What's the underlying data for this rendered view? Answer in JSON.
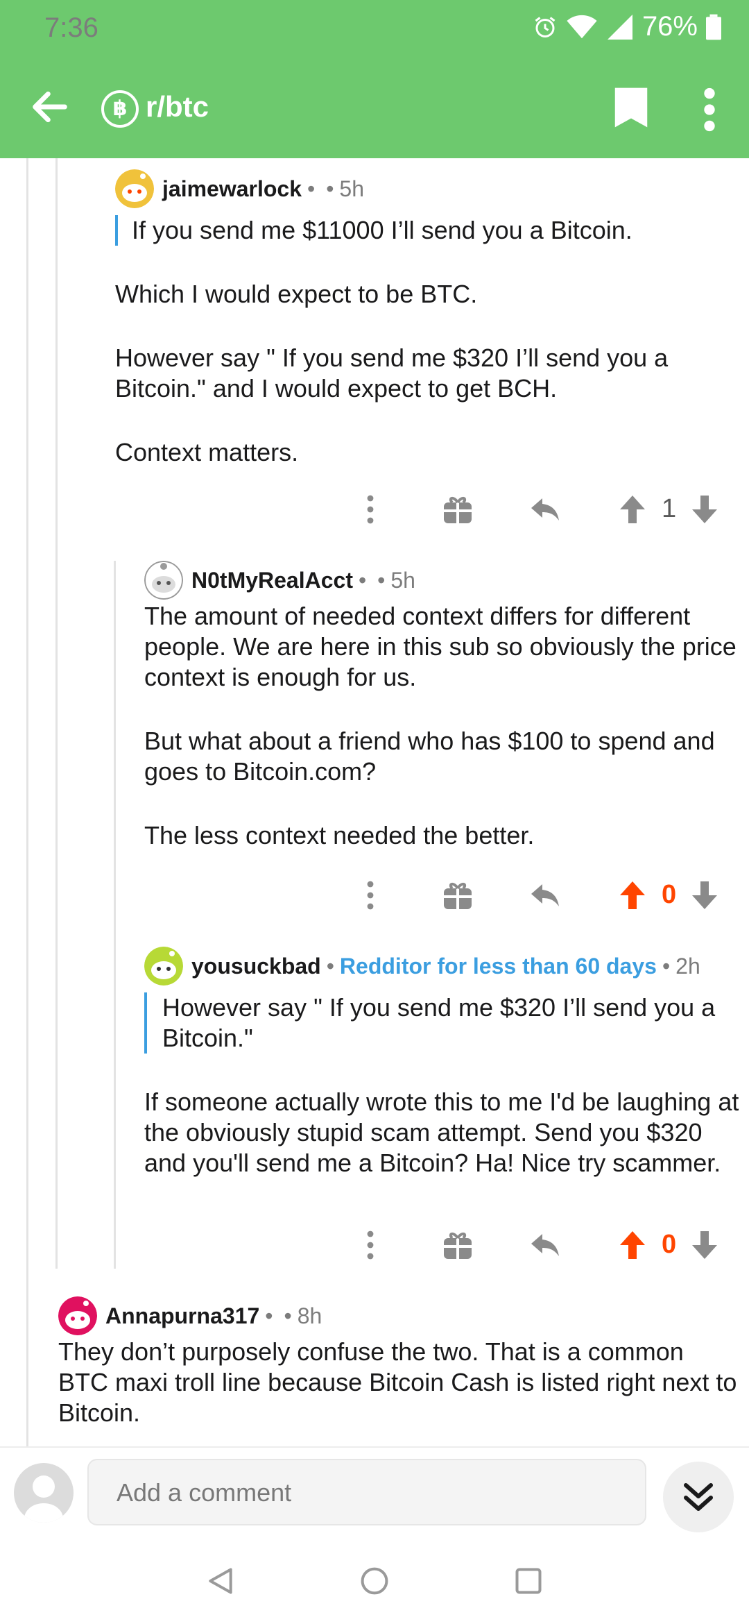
{
  "status_bar": {
    "time": "7:36",
    "battery": "76%"
  },
  "toolbar": {
    "subreddit": "r/btc",
    "back_icon": "arrow-left-icon",
    "bookmark_icon": "bookmark-icon",
    "more_icon": "more-vert-icon"
  },
  "comments": [
    {
      "username": "jaimewarlock",
      "time": "5h",
      "quote": "If you send me $11000 I’ll send you a Bitcoin.",
      "paragraphs": [
        "Which I would expect to be BTC.",
        "However say \" If you send me $320 I’ll send you a Bitcoin.\" and I would expect to get BCH.",
        "Context matters."
      ],
      "score": "1",
      "upvoted": false
    },
    {
      "username": "N0tMyRealAcct",
      "time": "5h",
      "paragraphs": [
        "The amount of needed context differs for different people. We are here in this sub so obviously the price context is enough for us.",
        "But what about a friend who has $100 to spend and goes to Bitcoin.com?",
        "The less context needed the better."
      ],
      "score": "0",
      "upvoted": true
    },
    {
      "username": "yousuckbad",
      "flair": "Redditor for less than 60 days",
      "time": "2h",
      "quote": "However say \" If you send me $320 I’ll send you a Bitcoin.\"",
      "paragraphs": [
        "If someone actually wrote this to me I'd be laughing at the obviously stupid scam attempt. Send you $320 and you'll send me a Bitcoin? Ha! Nice try scammer."
      ],
      "score": "0",
      "upvoted": true
    },
    {
      "username": "Annapurna317",
      "time": "8h",
      "paragraphs": [
        "They don’t purposely confuse the two. That is a common BTC maxi troll line because Bitcoin Cash is listed right next to Bitcoin."
      ]
    }
  ],
  "compose": {
    "placeholder": "Add a comment"
  },
  "colors": {
    "header": "#6dc96e",
    "upvote": "#ff4500",
    "link": "#3b9ee0"
  }
}
